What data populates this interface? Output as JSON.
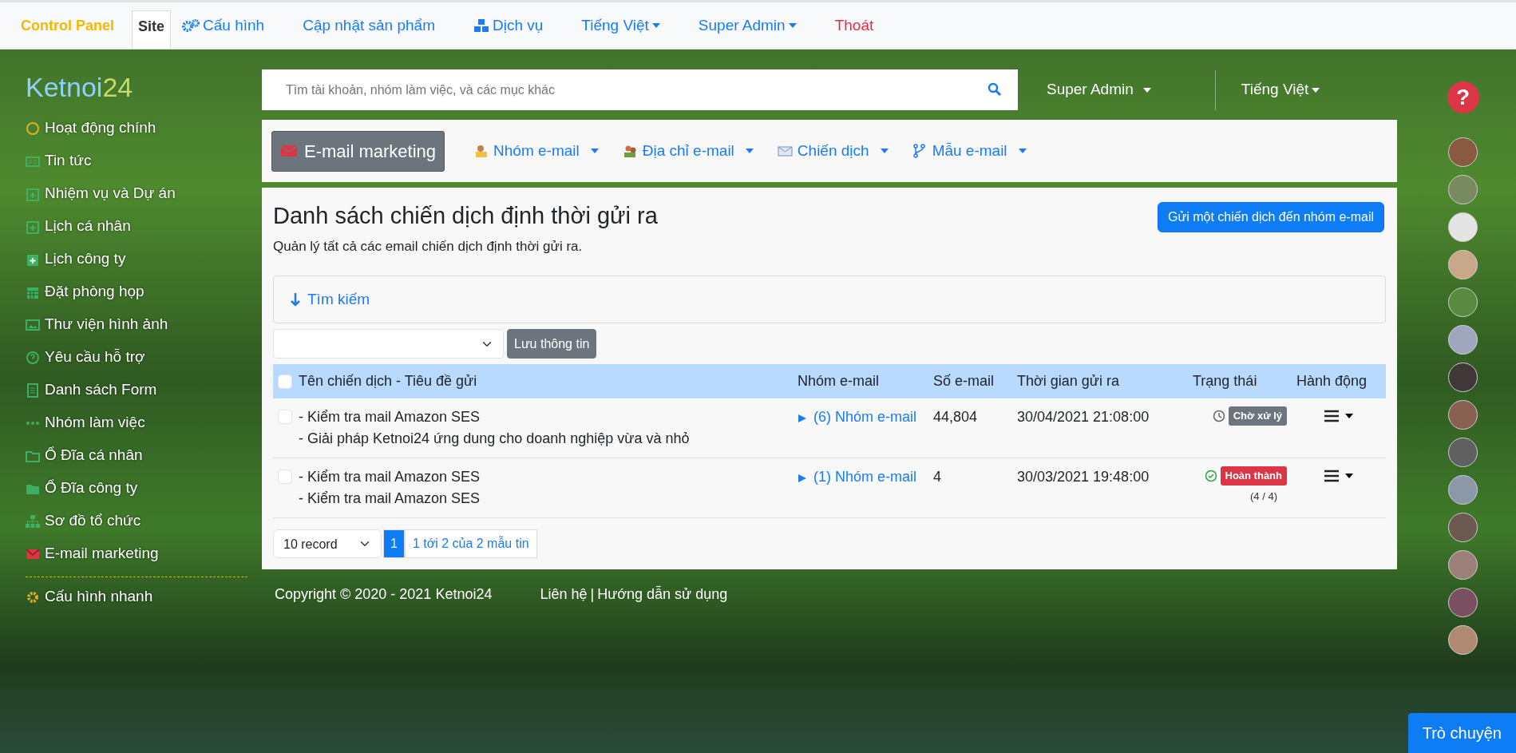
{
  "topnav": {
    "brand": "Control Panel",
    "items": [
      {
        "label": "Site",
        "kind": "tab",
        "selected": true
      },
      {
        "label": "Cấu hình",
        "kind": "gears",
        "selected": false
      },
      {
        "label": "Cập nhật sản phẩm",
        "kind": "plain",
        "selected": false
      },
      {
        "label": "Dịch vụ",
        "kind": "cubes",
        "selected": false
      },
      {
        "label": "Tiếng Việt",
        "kind": "dropdown",
        "selected": false
      },
      {
        "label": "Super Admin",
        "kind": "dropdown",
        "selected": false
      },
      {
        "label": "Thoát",
        "kind": "logout",
        "selected": false
      }
    ]
  },
  "sidebar": {
    "logo": [
      "Ketnoi",
      "24"
    ],
    "items": [
      {
        "label": "Hoạt động chính"
      },
      {
        "label": "Tin tức"
      },
      {
        "label": "Nhiệm vụ và Dự án"
      },
      {
        "label": "Lịch cá nhân"
      },
      {
        "label": "Lịch công ty"
      },
      {
        "label": "Đặt phòng họp"
      },
      {
        "label": "Thư viện hình ảnh"
      },
      {
        "label": "Yêu cầu hỗ trợ"
      },
      {
        "label": "Danh sách Form"
      },
      {
        "label": "Nhóm làm việc"
      },
      {
        "label": "Ổ Đĩa cá nhân"
      },
      {
        "label": "Ổ Đĩa công ty"
      },
      {
        "label": "Sơ đồ tổ chức"
      },
      {
        "label": "E-mail marketing"
      }
    ],
    "footer_item": {
      "label": "Cấu hình nhanh"
    }
  },
  "search": {
    "placeholder": "Tìm tài khoản, nhóm làm việc, và các mục khác"
  },
  "user_menu": "Super Admin",
  "language_menu": "Tiếng Việt",
  "module": {
    "title": "E-mail marketing",
    "menus": [
      "Nhóm e-mail",
      "Địa chỉ e-mail",
      "Chiến dịch",
      "Mẫu e-mail"
    ]
  },
  "page": {
    "title": "Danh sách chiến dịch định thời gửi ra",
    "subtitle": "Quản lý tất cả các email chiến dịch định thời gửi ra.",
    "action_button": "Gửi một chiến dịch đến nhóm e-mail",
    "search_toggle": "Tìm kiếm",
    "save_button": "Lưu thông tin"
  },
  "table": {
    "columns": [
      "Tên chiến dịch - Tiêu đề gửi",
      "Nhóm e-mail",
      "Số e-mail",
      "Thời gian gửi ra",
      "Trạng thái",
      "Hành động"
    ],
    "all_checked": false,
    "rows": [
      {
        "checked": false,
        "lines": [
          "- Kiểm tra mail Amazon SES",
          "- Giải pháp Ketnoi24 ứng dung cho doanh nghiệp vừa và nhỏ"
        ],
        "group": "(6) Nhóm e-mail",
        "count": "44,804",
        "time": "30/04/2021 21:08:00",
        "status": {
          "kind": "pending",
          "label": "Chờ xử lý"
        }
      },
      {
        "checked": false,
        "lines": [
          "- Kiểm tra mail Amazon SES",
          "- Kiểm tra mail Amazon SES"
        ],
        "group": "(1) Nhóm e-mail",
        "count": "4",
        "time": "30/03/2021 19:48:00",
        "status": {
          "kind": "done",
          "label": "Hoàn thành",
          "progress": "(4 / 4)"
        }
      }
    ]
  },
  "pagination": {
    "page_size": "10 record",
    "pages": [
      {
        "label": "1",
        "selected": true
      }
    ],
    "info": "1 tới 2 của 2 mẫu tin"
  },
  "footer": {
    "copyright": "Copyright © 2020 - 2021 Ketnoi24",
    "links": [
      "Liên hệ",
      "Hướng dẫn sử dụng"
    ],
    "separator": "|"
  },
  "help_button": "?",
  "online_users": [
    {
      "kind": "photo"
    },
    {
      "kind": "photo"
    },
    {
      "kind": "default"
    },
    {
      "kind": "photo"
    },
    {
      "kind": "photo"
    },
    {
      "kind": "photo"
    },
    {
      "kind": "photo"
    },
    {
      "kind": "photo"
    },
    {
      "kind": "photo"
    },
    {
      "kind": "photo"
    },
    {
      "kind": "photo"
    },
    {
      "kind": "photo"
    },
    {
      "kind": "photo"
    },
    {
      "kind": "photo"
    }
  ],
  "chat_button": "Trò chuyện"
}
